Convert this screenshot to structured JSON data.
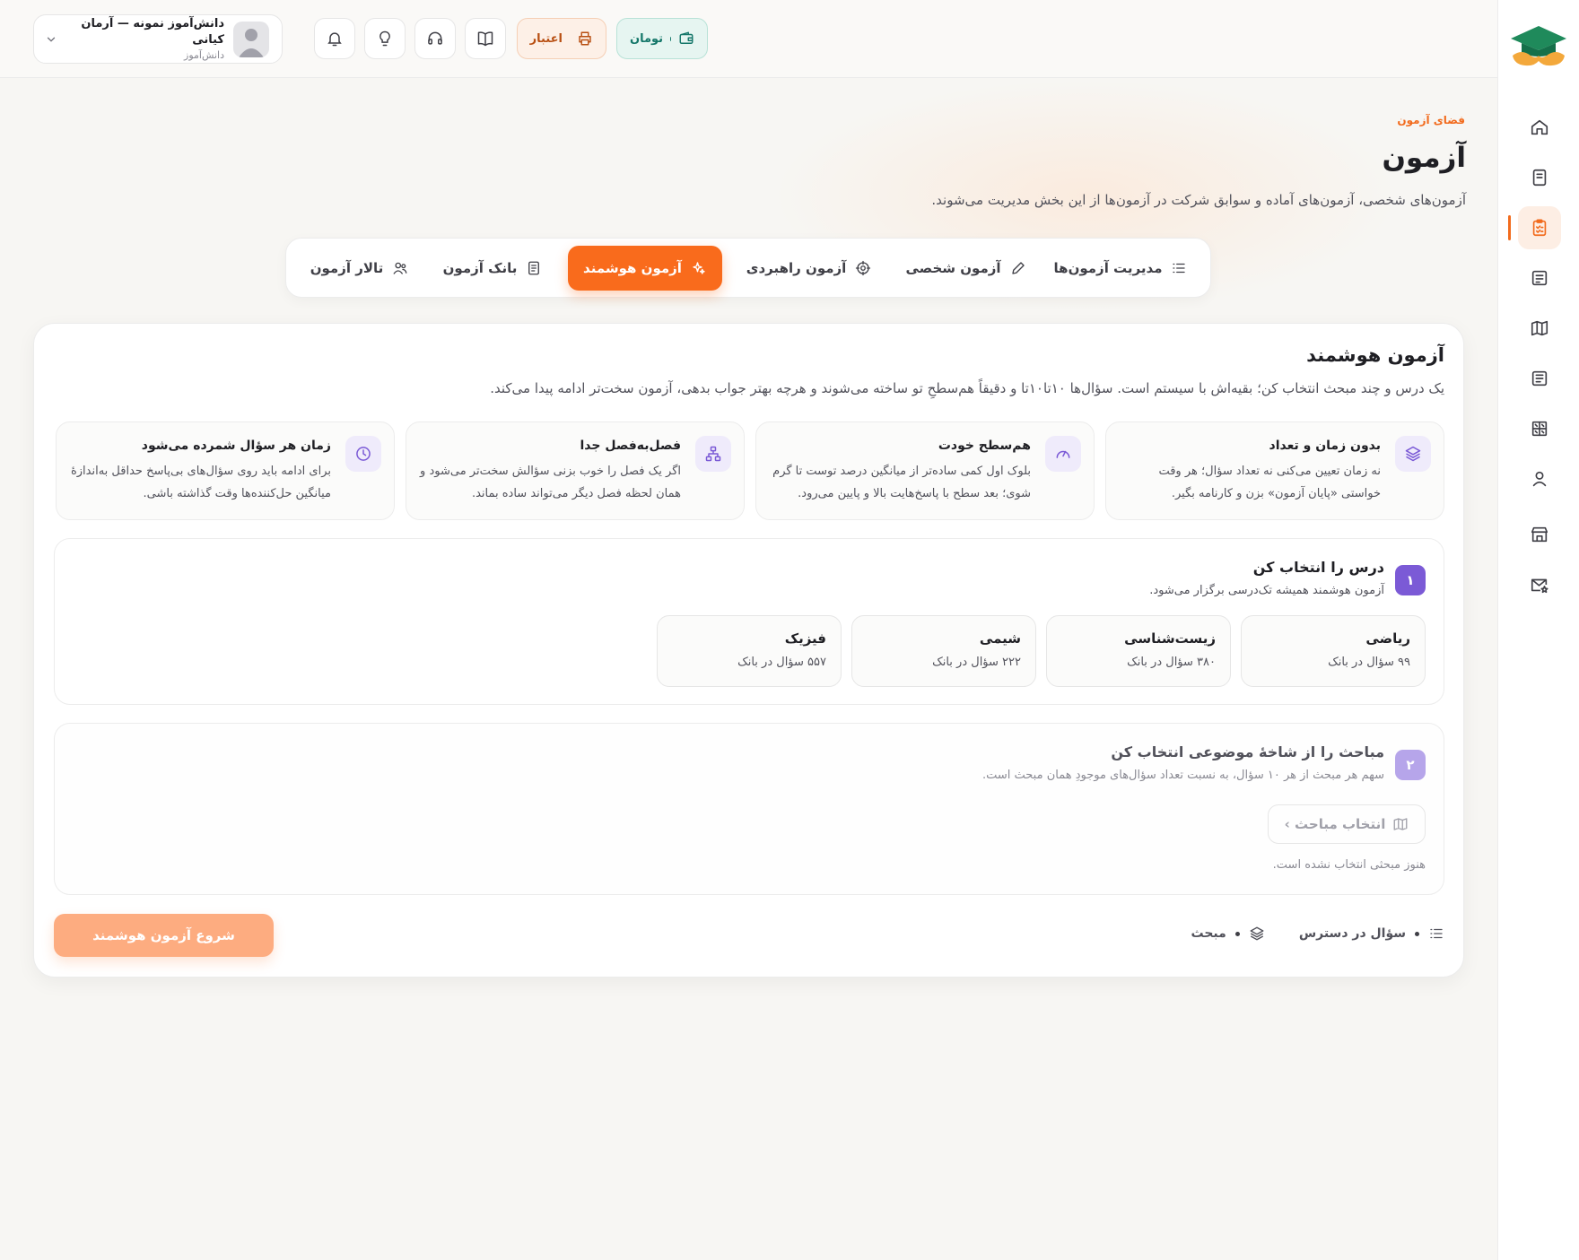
{
  "colors": {
    "accent": "#f96b1c",
    "purple": "#7b5ad6",
    "teal": "#15776a",
    "credit": "#b84f12"
  },
  "user": {
    "name": "دانش‌آموز نمونه — آرمان کیانی",
    "role": "دانش‌آموز"
  },
  "topbar": {
    "credit_label": "اعتبار",
    "toman_label": "تومان",
    "icons": [
      "bell-icon",
      "lightbulb-icon",
      "headset-icon",
      "book-open-icon"
    ]
  },
  "sidebar": {
    "items": [
      "home",
      "notebook",
      "exam",
      "file-text",
      "map",
      "newspaper",
      "puzzle",
      "user",
      "store",
      "mail-star"
    ],
    "active": "exam"
  },
  "header": {
    "breadcrumb": "فضای آزمون",
    "title": "آزمون",
    "description": "آزمون‌های شخصی، آزمون‌های آماده و سوابق شرکت در آزمون‌ها از این بخش مدیریت می‌شوند."
  },
  "tabs": [
    {
      "label": "مدیریت آزمون‌ها",
      "icon": "list-icon"
    },
    {
      "label": "آزمون شخصی",
      "icon": "pencil-icon"
    },
    {
      "label": "آزمون راهبردی",
      "icon": "crosshair-icon"
    },
    {
      "label": "آزمون هوشمند",
      "icon": "sparkle-icon",
      "active": true
    },
    {
      "label": "بانک آزمون",
      "icon": "document-icon"
    },
    {
      "label": "تالار آزمون",
      "icon": "users-icon"
    }
  ],
  "smart": {
    "title": "آزمون هوشمند",
    "description": "یک درس و چند مبحث انتخاب کن؛ بقیه‌اش با سیستم است. سؤال‌ها ۱۰تا۱۰تا و دقیقاً هم‌سطحِ تو ساخته می‌شوند و هرچه بهتر جواب بدهی، آزمون سخت‌تر ادامه پیدا می‌کند.",
    "features": [
      {
        "title": "بدون زمان و تعداد",
        "desc": "نه زمان تعیین می‌کنی نه تعداد سؤال؛ هر وقت خواستی «پایان آزمون» بزن و کارنامه بگیر."
      },
      {
        "title": "هم‌سطح خودت",
        "desc": "بلوک اول کمی ساده‌تر از میانگین درصد توست تا گرم شوی؛ بعد سطح با پاسخ‌هایت بالا و پایین می‌رود."
      },
      {
        "title": "فصل‌به‌فصل جدا",
        "desc": "اگر یک فصل را خوب بزنی سؤالش سخت‌تر می‌شود و همان لحظه فصل دیگر می‌تواند ساده بماند."
      },
      {
        "title": "زمان هر سؤال شمرده می‌شود",
        "desc": "برای ادامه باید روی سؤال‌های بی‌پاسخ حداقل به‌اندازهٔ میانگین حل‌کننده‌ها وقت گذاشته باشی."
      }
    ],
    "step1": {
      "number": "۱",
      "title": "درس را انتخاب کن",
      "subtitle": "آزمون هوشمند همیشه تک‌درسی برگزار می‌شود.",
      "subjects": [
        {
          "name": "ریاضی",
          "count": "۹۹ سؤال در بانک"
        },
        {
          "name": "زیست‌شناسی",
          "count": "۳۸۰ سؤال در بانک"
        },
        {
          "name": "شیمی",
          "count": "۲۲۲ سؤال در بانک"
        },
        {
          "name": "فیزیک",
          "count": "۵۵۷ سؤال در بانک"
        }
      ]
    },
    "step2": {
      "number": "۲",
      "title": "مباحث را از شاخهٔ موضوعی انتخاب کن",
      "subtitle": "سهم هر مبحث از هر ۱۰ سؤال، به نسبت تعداد سؤال‌های موجودِ همان مبحث است.",
      "button": "انتخاب مباحث ›",
      "empty": "هنوز مبحثی انتخاب نشده است."
    },
    "footer": {
      "questions_label": "سؤال در دسترس",
      "topics_label": "مبحث",
      "start_button": "شروع آزمون هوشمند"
    }
  }
}
